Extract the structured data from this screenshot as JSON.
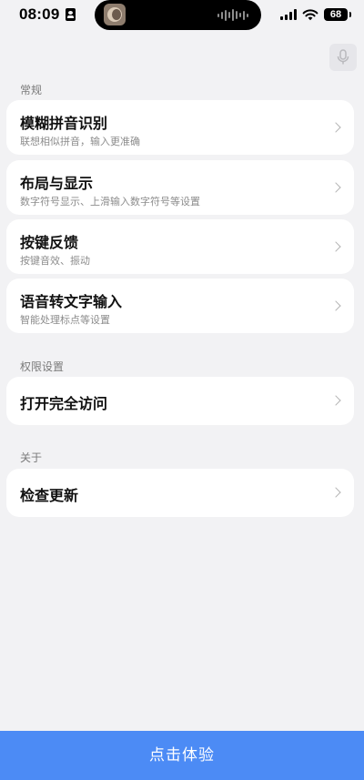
{
  "status_bar": {
    "time": "08:09",
    "battery": "68",
    "icons": [
      "id-card-icon",
      "voice-wave-icon",
      "signal-icon",
      "wifi-icon",
      "battery-icon"
    ]
  },
  "floating_key": {
    "icon": "microphone-icon"
  },
  "sections": [
    {
      "header": "常规",
      "items": [
        {
          "title": "模糊拼音识别",
          "subtitle": "联想相似拼音，输入更准确"
        },
        {
          "title": "布局与显示",
          "subtitle": "数字符号显示、上滑输入数字符号等设置"
        },
        {
          "title": "按键反馈",
          "subtitle": "按键音效、振动"
        },
        {
          "title": "语音转文字输入",
          "subtitle": "智能处理标点等设置"
        }
      ]
    },
    {
      "header": "权限设置",
      "items": [
        {
          "title": "打开完全访问"
        }
      ]
    },
    {
      "header": "关于",
      "items": [
        {
          "title": "检查更新"
        }
      ]
    }
  ],
  "bottom_button": {
    "label": "点击体验"
  },
  "colors": {
    "background": "#f2f2f4",
    "card": "#ffffff",
    "accent": "#4c8bf5",
    "secondary_text": "#8c8c8c"
  }
}
